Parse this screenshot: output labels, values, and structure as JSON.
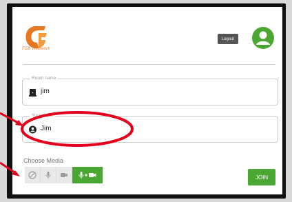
{
  "app": {
    "logo_text": "FSB Webwork"
  },
  "header": {
    "logout_label": "Logout"
  },
  "form": {
    "room": {
      "label": "Room name",
      "value": "jim",
      "icon": "door-icon"
    },
    "name": {
      "label": "Your name",
      "value": "Jim",
      "icon": "user-icon"
    }
  },
  "media": {
    "label": "Choose Media",
    "options": [
      {
        "icon": "none-icon"
      },
      {
        "icon": "microphone-icon"
      },
      {
        "icon": "video-camera-icon"
      },
      {
        "icon": "microphone-video-icon",
        "selected": true
      }
    ]
  },
  "actions": {
    "join_label": "JOIN"
  },
  "colors": {
    "accent": "#4aa832",
    "brand": "#e87722",
    "annotation": "#e3001b"
  }
}
